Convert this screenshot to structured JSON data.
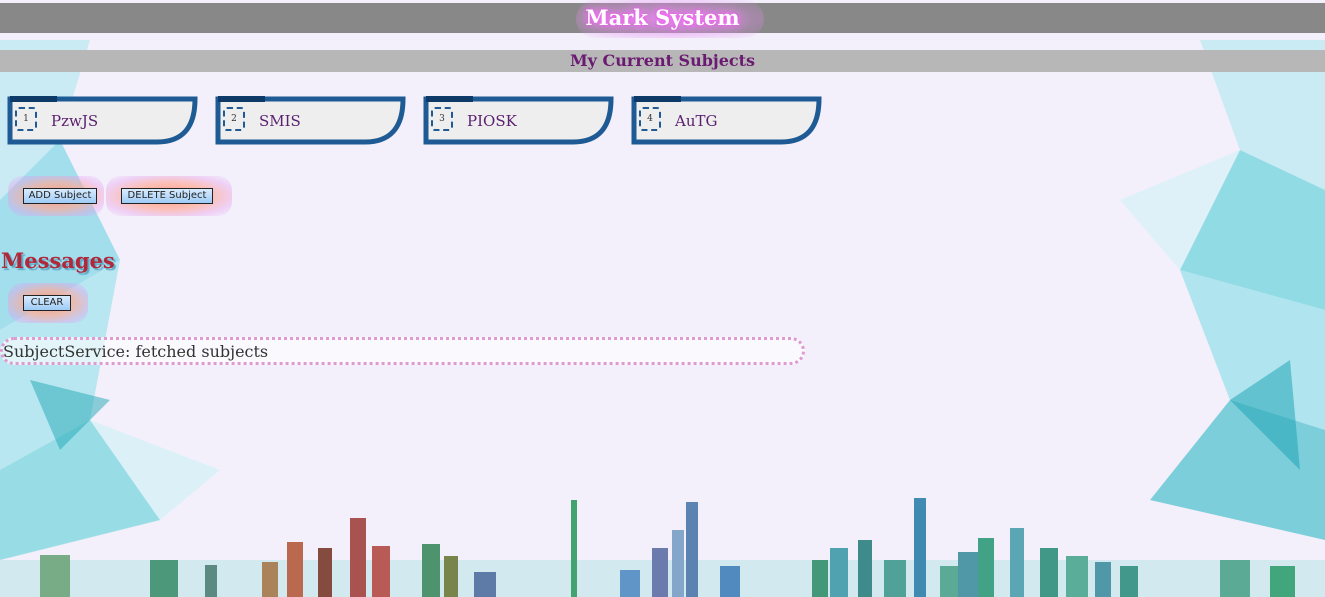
{
  "header": {
    "title": "Mark System"
  },
  "subheader": {
    "title": "My Current Subjects"
  },
  "subjects": [
    {
      "id": "1",
      "name": "PzwJS"
    },
    {
      "id": "2",
      "name": "SMIS"
    },
    {
      "id": "3",
      "name": "PIOSK"
    },
    {
      "id": "4",
      "name": "AuTG"
    }
  ],
  "actions": {
    "add_label": "ADD Subject",
    "delete_label": "DELETE Subject"
  },
  "messages": {
    "heading": "Messages",
    "clear_label": "CLEAR",
    "items": [
      "SubjectService: fetched subjects"
    ]
  },
  "colors": {
    "header_bar": "#888888",
    "subheader_bar": "#b7b7b7",
    "card_border": "#1e5a94",
    "card_fill": "#eeeeee",
    "subject_text": "#5a1f6e",
    "messages_heading": "#b0283a"
  }
}
